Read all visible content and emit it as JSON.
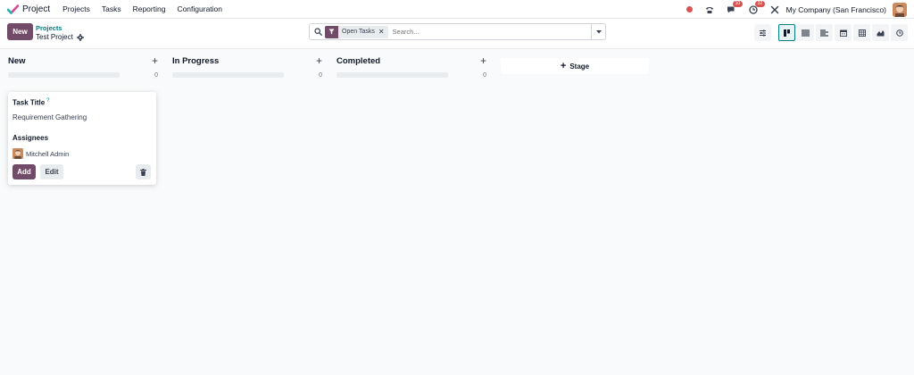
{
  "navbar": {
    "app_name": "Project",
    "menu": [
      "Projects",
      "Tasks",
      "Reporting",
      "Configuration"
    ],
    "messages_count": "10",
    "activities_count": "32",
    "company": "My Company (San Francisco)"
  },
  "control": {
    "new_label": "New",
    "breadcrumb_parent": "Projects",
    "breadcrumb_current": "Test Project",
    "facet_label": "Open Tasks",
    "search_placeholder": "Search..."
  },
  "columns": [
    {
      "title": "New",
      "count": "0"
    },
    {
      "title": "In Progress",
      "count": "0"
    },
    {
      "title": "Completed",
      "count": "0"
    }
  ],
  "add_stage_label": "Stage",
  "quick_create": {
    "task_title_label": "Task Title",
    "task_title_help": "?",
    "task_title_value": "Requirement Gathering",
    "assignees_label": "Assignees",
    "assignee_name": "Mitchell Admin",
    "add_label": "Add",
    "edit_label": "Edit"
  },
  "colors": {
    "brand": "#714b67",
    "accent": "#017e84",
    "badge": "#d9534f"
  }
}
